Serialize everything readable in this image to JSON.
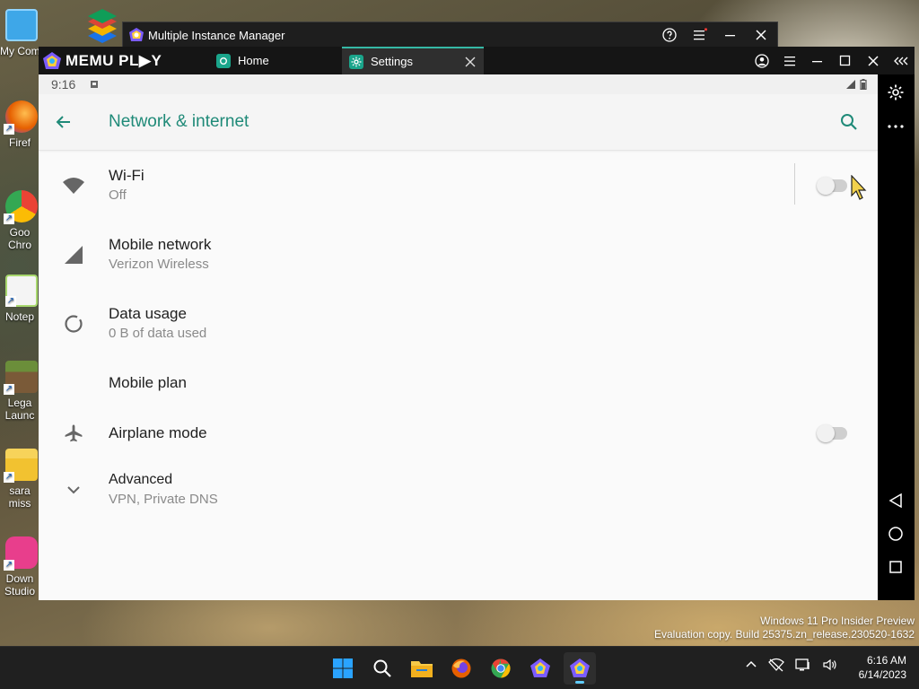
{
  "desktop": {
    "icons": [
      {
        "label": "My Com",
        "color": "#3ea7e8"
      },
      {
        "label": "Firef",
        "color": "#e66000"
      },
      {
        "label": "Goo",
        "label2": "Chro",
        "color": "#4285f4"
      },
      {
        "label": "Notep",
        "color": "#a8d86e"
      },
      {
        "label": "Lega",
        "label2": "Launc",
        "color": "#6b8e3a"
      },
      {
        "label": "sara",
        "label2": "miss",
        "color": "#f2c230"
      },
      {
        "label": "Down",
        "label2": "Studio",
        "color": "#e83e8c"
      }
    ]
  },
  "instance_manager": {
    "title": "Multiple Instance Manager"
  },
  "memu": {
    "brand": "MEMU PL▶Y",
    "tabs": [
      {
        "label": "Home",
        "active": false
      },
      {
        "label": "Settings",
        "active": true
      }
    ]
  },
  "android": {
    "status_time": "9:16",
    "header_title": "Network & internet",
    "items": [
      {
        "title": "Wi-Fi",
        "subtitle": "Off",
        "icon": "wifi-icon",
        "toggle": "off"
      },
      {
        "title": "Mobile network",
        "subtitle": "Verizon Wireless",
        "icon": "signal-icon"
      },
      {
        "title": "Data usage",
        "subtitle": "0 B of data used",
        "icon": "data-usage-icon"
      },
      {
        "title": "Mobile plan",
        "subtitle": ""
      },
      {
        "title": "Airplane mode",
        "subtitle": "",
        "icon": "airplane-icon",
        "toggle": "off"
      },
      {
        "title": "Advanced",
        "subtitle": "VPN, Private DNS",
        "icon": "chevron-down-icon"
      }
    ]
  },
  "watermark": {
    "line1": "Windows 11 Pro Insider Preview",
    "line2": "Evaluation copy. Build 25375.zn_release.230520-1632"
  },
  "taskbar": {
    "time": "6:16 AM",
    "date": "6/14/2023"
  },
  "colors": {
    "accent": "#1f8a78",
    "tab_highlight": "#35b8a5"
  }
}
